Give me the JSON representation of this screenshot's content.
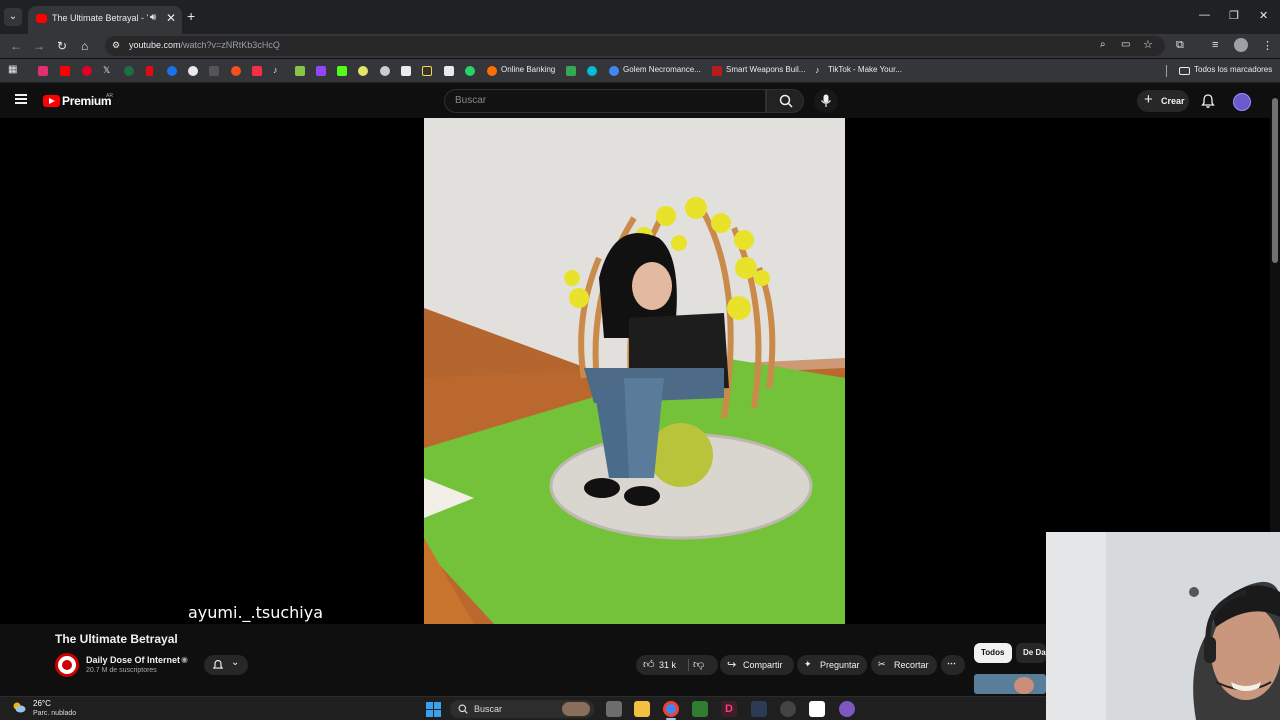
{
  "browser": {
    "tab_title": "The Ultimate Betrayal - You",
    "url_host": "youtube.com",
    "url_path": "/watch?v=zNRtKb3cHcQ",
    "bookmarks": [
      {
        "label": "Online Banking",
        "icon": "banking-icon"
      },
      {
        "label": "Golem Necromance...",
        "icon": "golem-icon"
      },
      {
        "label": "Smart Weapons Buil...",
        "icon": "weapons-icon"
      },
      {
        "label": "TikTok - Make Your...",
        "icon": "tiktok-icon"
      }
    ],
    "all_bookmarks_label": "Todos los marcadores"
  },
  "youtube": {
    "brand_label": "Premium",
    "region": "AR",
    "search_placeholder": "Buscar",
    "create_label": "Crear"
  },
  "video": {
    "watermark": "ayumi._.tsuchiya",
    "title": "The Ultimate Betrayal",
    "channel_name": "Daily Dose Of Internet",
    "subscribers": "20.7 M de suscriptores",
    "likes": "31 k",
    "share_label": "Compartir",
    "ask_label": "Preguntar",
    "clip_label": "Recortar"
  },
  "chips": {
    "all": "Todos",
    "from": "De Da"
  },
  "taskbar": {
    "temperature": "26°C",
    "weather": "Parc. nublado",
    "search_label": "Buscar"
  },
  "colors": {
    "youtube_red": "#ff0000",
    "page_bg": "#0f0f0f",
    "chip_active_bg": "#f1f1f1"
  }
}
